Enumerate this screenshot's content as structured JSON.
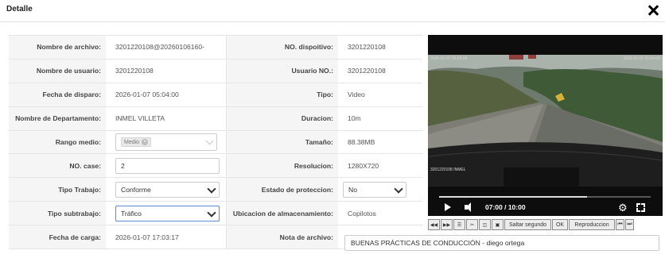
{
  "dialog": {
    "title": "Detalle"
  },
  "fields": {
    "nombre_archivo": {
      "label": "Nombre de archivo:",
      "value": "3201220108@20260106160-"
    },
    "nombre_usuario": {
      "label": "Nombre de usuario:",
      "value": "3201220108"
    },
    "fecha_disparo": {
      "label": "Fecha de disparo:",
      "value": "2026-01-07 05:04:00"
    },
    "departamento": {
      "label": "Nombre de Departamento:",
      "value": "INMEL VILLETA"
    },
    "rango_medio": {
      "label": "Rango medio:",
      "tag": "Medio",
      "tag_remove": "×"
    },
    "no_case": {
      "label": "NO. case:",
      "value": "2"
    },
    "tipo_trabajo": {
      "label": "Tipo Trabajo:",
      "value": "Conforme"
    },
    "tipo_subtrabajo": {
      "label": "Tipo subtrabajo:",
      "value": "Tráfico"
    },
    "fecha_carga": {
      "label": "Fecha de carga:",
      "value": "2026-01-07 17:03:17"
    },
    "no_dispositivo": {
      "label": "NO. dispoitivo:",
      "value": "3201220108"
    },
    "usuario_no": {
      "label": "Usuario NO.:",
      "value": "3201220108"
    },
    "tipo": {
      "label": "Tipo:",
      "value": "Video"
    },
    "duracion": {
      "label": "Duracion:",
      "value": "10m"
    },
    "tamano": {
      "label": "Tamaño:",
      "value": "88.38MB"
    },
    "resolucion": {
      "label": "Resolucion:",
      "value": "1280X720"
    },
    "estado_proteccion": {
      "label": "Estado de proteccion:",
      "value": "No"
    },
    "ubicacion": {
      "label": "Ubicacion de almacenamiento:",
      "value": "Copilotos"
    },
    "nota": {
      "label": "Nota de archivo:",
      "value": "BUENAS PRÁCTICAS DE CONDUCCIÓN - diego ortega"
    }
  },
  "player": {
    "time": "07:00 / 10:00",
    "progress": 0.7,
    "overlay_top_left": "2026-01-07 05:04:00",
    "overlay_top_right": "2026-01-07 05:04:00",
    "overlay_bottom": "3201220108 INMEL"
  },
  "toolbar": {
    "saltar_label": "Saltar segundo",
    "ok_label": "OK",
    "reproduccion_label": "Reproduccion",
    "icons": [
      "rewind-icon",
      "fast-forward-icon",
      "list-icon",
      "scissors-icon",
      "capture-icon",
      "export-icon",
      "previous-icon",
      "next-icon"
    ]
  },
  "colors": {
    "accent": "#5b8cd6",
    "label_bg": "#f5f5f5"
  }
}
